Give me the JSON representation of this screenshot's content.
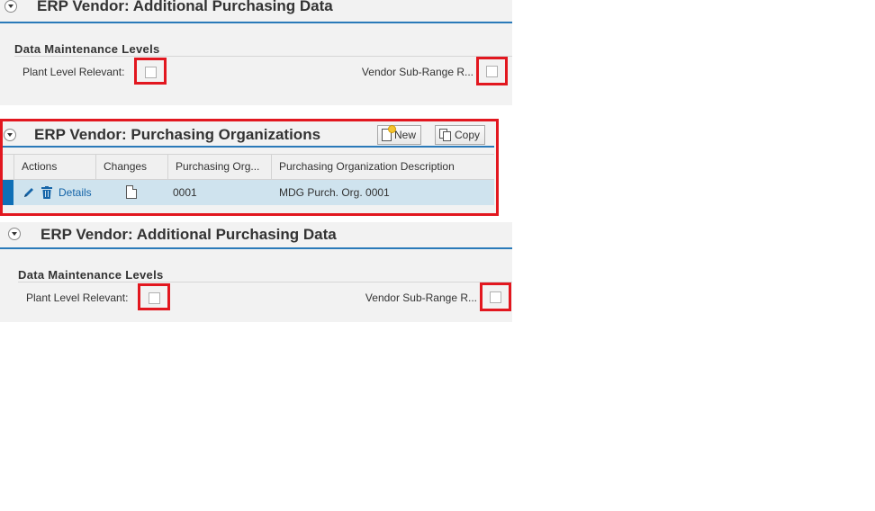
{
  "panel_top": {
    "title": "ERP Vendor: Additional Purchasing Data",
    "group_title": "Data Maintenance Levels",
    "plant_label": "Plant Level Relevant:",
    "vendor_label": "Vendor Sub-Range R...",
    "plant_checked": false,
    "vendor_checked": false
  },
  "panel_orgs": {
    "title": "ERP Vendor: Purchasing Organizations",
    "new_label": "New",
    "copy_label": "Copy",
    "columns": [
      "Actions",
      "Changes",
      "Purchasing Org...",
      "Purchasing Organization Description"
    ],
    "rows": [
      {
        "details_label": "Details",
        "org": "0001",
        "description": "MDG Purch. Org. 0001"
      }
    ]
  },
  "panel_bottom": {
    "title": "ERP Vendor: Additional Purchasing Data",
    "group_title": "Data Maintenance Levels",
    "plant_label": "Plant Level Relevant:",
    "vendor_label": "Vendor Sub-Range R...",
    "plant_checked": false,
    "vendor_checked": false
  },
  "colors": {
    "accent_line": "#2a7ab9",
    "highlight": "#e2171f",
    "row_selected": "#cfe3ee",
    "row_selector": "#0f6fb6",
    "link": "#1464a8"
  }
}
